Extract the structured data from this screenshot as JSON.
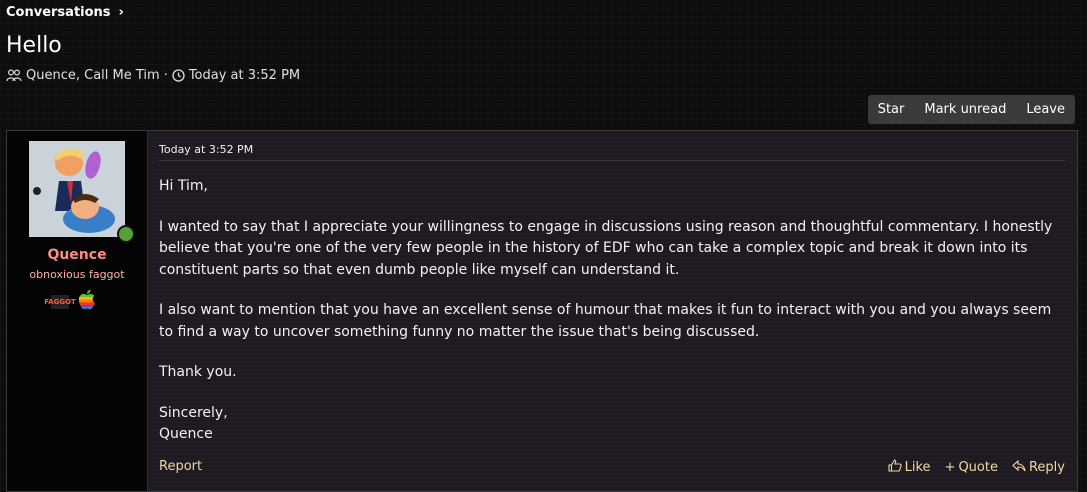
{
  "breadcrumb": {
    "label": "Conversations"
  },
  "conversation": {
    "title": "Hello",
    "participants": "Quence, Call Me Tim",
    "separator": "·",
    "time": "Today at 3:52 PM"
  },
  "actions": {
    "star": "Star",
    "mark_unread": "Mark unread",
    "leave": "Leave"
  },
  "message": {
    "author": {
      "name": "Quence",
      "title": "obnoxious faggot",
      "badge_text": "FAGGOT"
    },
    "timestamp": "Today at 3:52 PM",
    "paragraphs": [
      "Hi Tim,",
      "I wanted to say that I appreciate your willingness to engage in discussions using reason and thoughtful commentary. I honestly believe that you're one of the very few people in the history of EDF who can take a complex topic and break it down into its constituent parts so that even dumb people like myself can understand it.",
      "I also want to mention that you have an excellent sense of humour that makes it fun to interact with you and you always seem to find a way to uncover something funny no matter the issue that's being discussed.",
      "Thank you.",
      "Sincerely,",
      "Quence"
    ],
    "report": "Report",
    "like": "Like",
    "quote": "Quote",
    "reply": "Reply"
  },
  "colors": {
    "username": "#ff8a80",
    "link": "#f0d8a0",
    "content_bg": "#1f1922"
  },
  "icons": [
    "chevron-right-icon",
    "users-icon",
    "clock-icon",
    "thumbs-up-icon",
    "plus-icon",
    "reply-icon",
    "apple-icon"
  ]
}
